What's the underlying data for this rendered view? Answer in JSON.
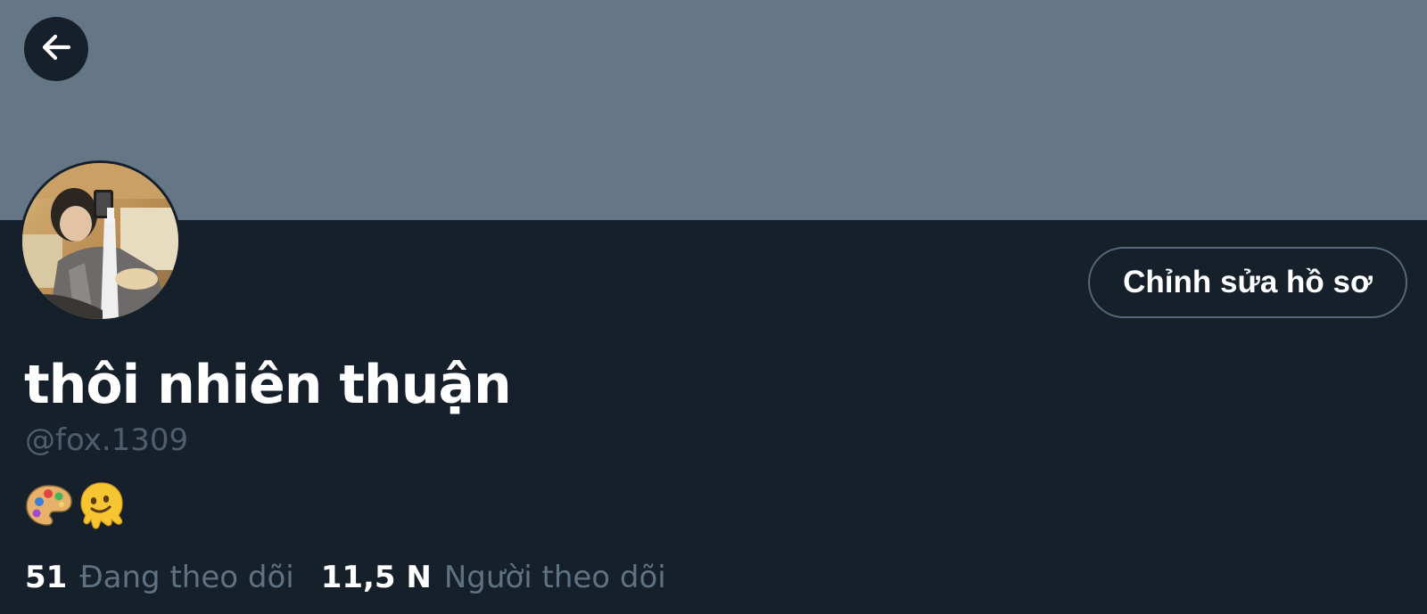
{
  "header": {
    "back_icon": "arrow-left-icon",
    "banner_color": "#657786"
  },
  "profile": {
    "avatar": "profile-photo",
    "edit_button_label": "Chỉnh sửa hồ sơ",
    "display_name": "thôi nhiên thuận",
    "handle": "@fox.1309",
    "bio_icons": [
      "artist-palette-icon",
      "melting-face-icon"
    ]
  },
  "stats": {
    "following": {
      "count": "51",
      "label": "Đang theo dõi"
    },
    "followers": {
      "count": "11,5 N",
      "label": "Người theo dõi"
    }
  },
  "colors": {
    "background": "#16202b",
    "muted_text": "#5f7282",
    "button_border": "#56687a"
  }
}
